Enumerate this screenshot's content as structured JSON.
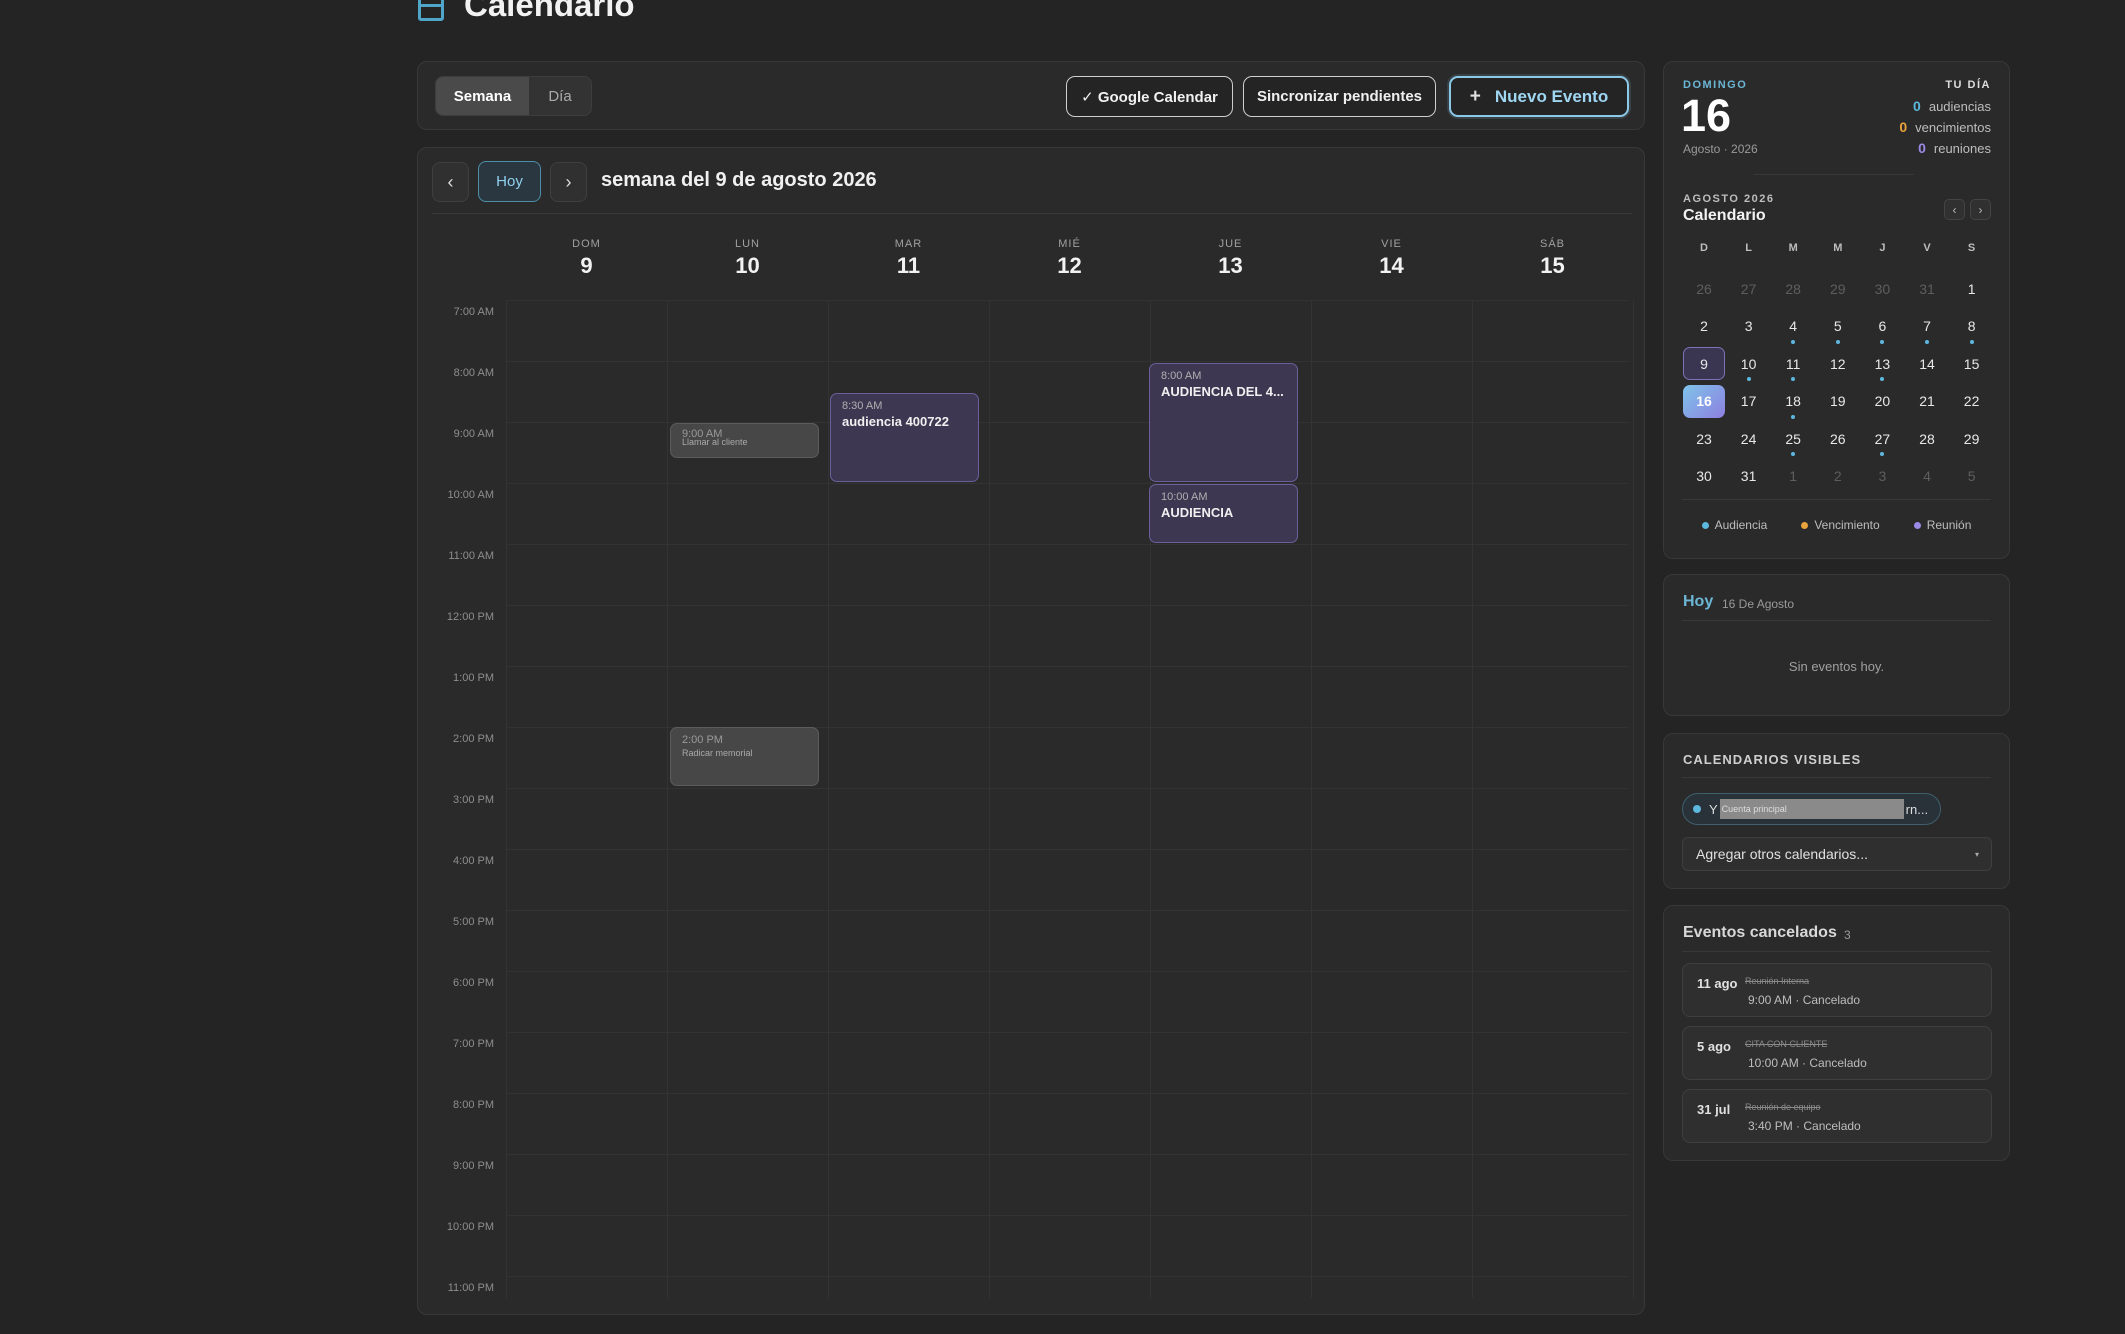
{
  "header": {
    "title": "Calendario"
  },
  "toolbar": {
    "view_week": "Semana",
    "view_day": "Día",
    "google_calendar": "✓ Google Calendar",
    "sync_pending": "Sincronizar pendientes",
    "new_event": "Nuevo Evento",
    "new_event_plus": "+"
  },
  "week": {
    "prev": "‹",
    "today": "Hoy",
    "next": "›",
    "title": "semana del 9 de agosto 2026",
    "days": [
      {
        "name": "DOM",
        "num": "9"
      },
      {
        "name": "LUN",
        "num": "10"
      },
      {
        "name": "MAR",
        "num": "11"
      },
      {
        "name": "MIÉ",
        "num": "12"
      },
      {
        "name": "JUE",
        "num": "13"
      },
      {
        "name": "VIE",
        "num": "14"
      },
      {
        "name": "SÁB",
        "num": "15"
      }
    ],
    "hours": [
      "7:00 AM",
      "8:00 AM",
      "9:00 AM",
      "10:00 AM",
      "11:00 AM",
      "12:00 PM",
      "1:00 PM",
      "2:00 PM",
      "3:00 PM",
      "4:00 PM",
      "5:00 PM",
      "6:00 PM",
      "7:00 PM",
      "8:00 PM",
      "9:00 PM",
      "10:00 PM",
      "11:00 PM"
    ],
    "events": [
      {
        "time": "9:00 AM",
        "name": "Llamar al cliente"
      },
      {
        "time": "2:00 PM",
        "name": "Radicar memorial"
      },
      {
        "time": "8:30 AM",
        "name": "audiencia 400722"
      },
      {
        "time": "8:00 AM",
        "name": "AUDIENCIA DEL 4..."
      },
      {
        "time": "10:00 AM",
        "name": "AUDIENCIA"
      }
    ]
  },
  "summary": {
    "weekday": "DOMINGO",
    "day": "16",
    "month_year": "Agosto · 2026",
    "your_day": "TU DÍA",
    "stats": [
      {
        "n": "0",
        "label": "audiencias",
        "color": "#5cb8de"
      },
      {
        "n": "0",
        "label": "vencimientos",
        "color": "#e8a33c"
      },
      {
        "n": "0",
        "label": "reuniones",
        "color": "#9b8ae6"
      }
    ]
  },
  "mini_calendar": {
    "label": "AGOSTO 2026",
    "title": "Calendario",
    "prev": "‹",
    "next": "›",
    "weekdays": [
      "D",
      "L",
      "M",
      "M",
      "J",
      "V",
      "S"
    ],
    "rows": [
      [
        "26",
        "27",
        "28",
        "29",
        "30",
        "31",
        "1"
      ],
      [
        "2",
        "3",
        "4",
        "5",
        "6",
        "7",
        "8"
      ],
      [
        "9",
        "10",
        "11",
        "12",
        "13",
        "14",
        "15"
      ],
      [
        "16",
        "17",
        "18",
        "19",
        "20",
        "21",
        "22"
      ],
      [
        "23",
        "24",
        "25",
        "26",
        "27",
        "28",
        "29"
      ],
      [
        "30",
        "31",
        "1",
        "2",
        "3",
        "4",
        "5"
      ]
    ],
    "legend": [
      {
        "label": "Audiencia",
        "color": "#5cb8de"
      },
      {
        "label": "Vencimiento",
        "color": "#e8a33c"
      },
      {
        "label": "Reunión",
        "color": "#9b8ae6"
      }
    ]
  },
  "today_panel": {
    "title": "Hoy",
    "date": "16 De Agosto",
    "empty": "Sin eventos hoy."
  },
  "visible_calendars": {
    "title": "CALENDARIOS VISIBLES",
    "chip_prefix": "Y",
    "chip_redacted": "Cuenta principal",
    "chip_suffix": "rn...",
    "add_other": "Agregar otros calendarios...",
    "add_caret": "▾"
  },
  "cancelled": {
    "title": "Eventos cancelados",
    "count": "3",
    "items": [
      {
        "date": "11 ago",
        "name": "Reunión Interna",
        "status": "9:00 AM · Cancelado"
      },
      {
        "date": "5 ago",
        "name": "CITA CON CLIENTE",
        "status": "10:00 AM · Cancelado"
      },
      {
        "date": "31 jul",
        "name": "Reunión de equipo",
        "status": "3:40 PM · Cancelado"
      }
    ]
  }
}
